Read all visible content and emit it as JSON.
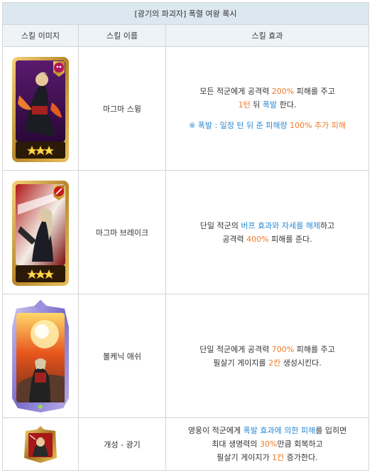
{
  "table": {
    "title": "[광기의 파괴자] 폭렬 여왕 록시",
    "headers": [
      "스킬 이미지",
      "스킬 이름",
      "스킬 효과"
    ],
    "rows": [
      {
        "name": "마그마 스윙",
        "effect": {
          "l1_a": "모든 적군에게 공격력 ",
          "l1_b": "200%",
          "l1_c": " 피해를 주고",
          "l2_a": "1턴",
          "l2_b": " 뒤 ",
          "l2_c": "폭발",
          "l2_d": " 한다.",
          "note_a": "※ 폭발 : 일정 턴 뒤 준 피해량 ",
          "note_b": "100% 추가 피해"
        }
      },
      {
        "name": "마그마 브레이크",
        "effect": {
          "l1_a": "단일 적군의 ",
          "l1_b": "버프 효과와 자세를 해제",
          "l1_c": "하고",
          "l2_a": "공격력 ",
          "l2_b": "400%",
          "l2_c": " 피해를 준다."
        }
      },
      {
        "name": "볼케닉 애쉬",
        "effect": {
          "l1_a": "단일 적군에게 공격력 ",
          "l1_b": "700%",
          "l1_c": " 피해를 주고",
          "l2_a": "필살기 게이지를 ",
          "l2_b": "2칸",
          "l2_c": " 생성시킨다."
        }
      },
      {
        "name": "개성 - 광기",
        "effect": {
          "l1_a": "영웅이 적군에게 ",
          "l1_b": "폭발 효과에 의한 피해",
          "l1_c": "를 입히면",
          "l2_a": "최대 생명력의 ",
          "l2_b": "30%",
          "l2_c": "만큼 회복하고",
          "l3_a": "필살기 게이지가 ",
          "l3_b": "1칸",
          "l3_c": " 증가한다."
        }
      }
    ]
  },
  "colors": {
    "title_bg": "#dce8ef",
    "header_bg": "#edf3f7",
    "highlight_orange": "#f07a2a",
    "highlight_blue": "#2a8ad3",
    "border": "#d5d5d5"
  },
  "icons": {
    "row1": "skull-icon",
    "row2": "sword-icon",
    "row3": "diamond-frame-icon",
    "row4": "portrait-icon"
  }
}
